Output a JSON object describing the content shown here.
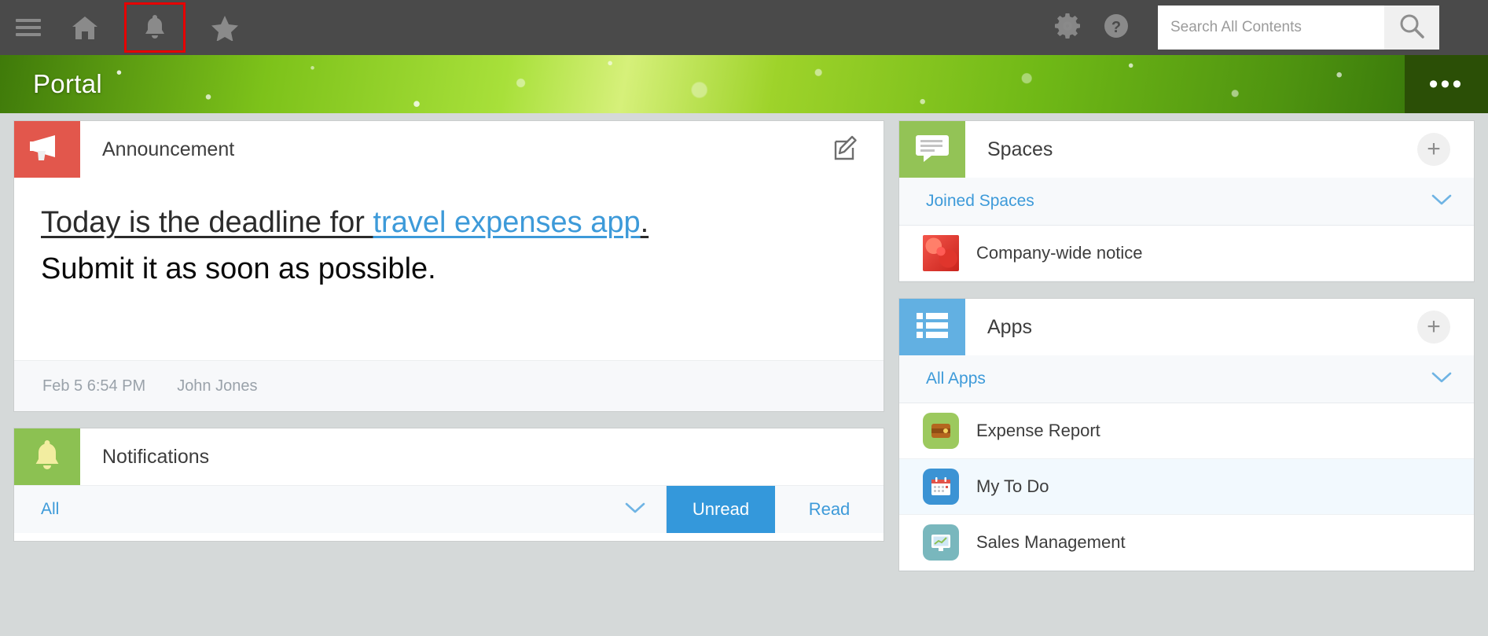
{
  "topbar": {
    "menu_icon": "hamburger-menu-icon",
    "home_icon": "home-icon",
    "bell_icon": "bell-icon",
    "star_icon": "star-icon",
    "gear_icon": "gear-icon",
    "help_icon": "help-icon",
    "search_placeholder": "Search All Contents",
    "search_value": "",
    "search_icon": "search-icon",
    "background": "#4a4a4a",
    "highlight_color": "#e60000"
  },
  "banner": {
    "title": "Portal",
    "more_label": "•••"
  },
  "announcement": {
    "title": "Announcement",
    "badge_icon": "megaphone-icon",
    "edit_icon": "edit-icon",
    "body_line1_prefix": "Today is the deadline for ",
    "body_line1_link": "travel expenses app",
    "body_line1_suffix": ".",
    "body_line2": "Submit it as soon as possible.",
    "timestamp": "Feb 5 6:54 PM",
    "author": "John Jones",
    "link_color": "#3d9ad9"
  },
  "notifications": {
    "title": "Notifications",
    "badge_icon": "bell-icon",
    "filter_label": "All",
    "filter_chevron": "chevron-down-icon",
    "tabs": [
      {
        "label": "Unread",
        "active": true
      },
      {
        "label": "Read",
        "active": false
      }
    ],
    "active_color": "#3498db"
  },
  "spaces": {
    "title": "Spaces",
    "badge_icon": "speech-bubble-icon",
    "add_icon": "plus-icon",
    "group_label": "Joined Spaces",
    "group_chevron": "chevron-down-icon",
    "items": [
      {
        "label": "Company-wide notice",
        "thumb": "rose-photo-thumbnail"
      }
    ]
  },
  "apps": {
    "title": "Apps",
    "badge_icon": "list-icon",
    "add_icon": "plus-icon",
    "group_label": "All Apps",
    "group_chevron": "chevron-down-icon",
    "items": [
      {
        "label": "Expense Report",
        "icon": "wallet-icon",
        "highlighted": false
      },
      {
        "label": "My To Do",
        "icon": "calendar-icon",
        "highlighted": true
      },
      {
        "label": "Sales Management",
        "icon": "monitor-chart-icon",
        "highlighted": false
      }
    ]
  }
}
